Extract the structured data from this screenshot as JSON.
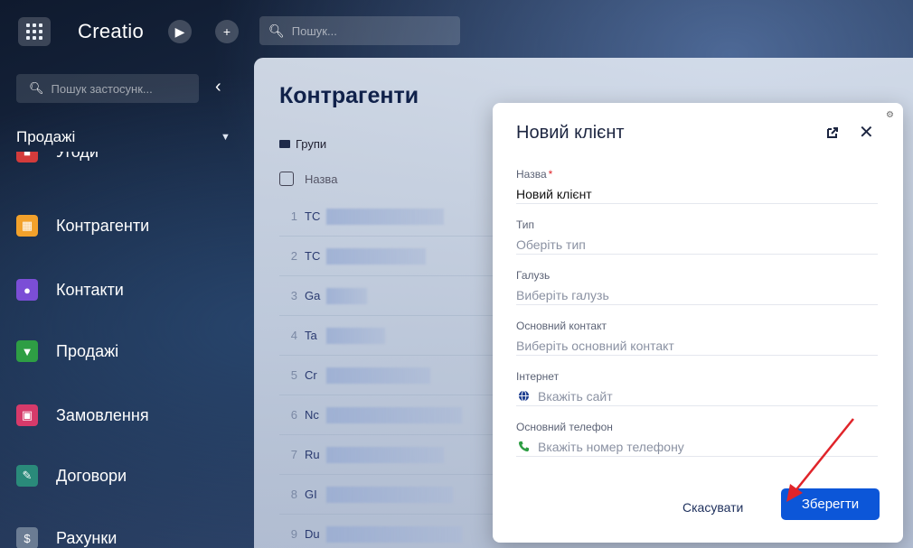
{
  "topbar": {
    "logo": "Creatio",
    "search_placeholder": "Пошук..."
  },
  "sidebar": {
    "search_placeholder": "Пошук застосунк...",
    "section_title": "Продажі",
    "items": [
      {
        "label": "Угоди",
        "icon": "deals-icon",
        "color": "#d33b3b"
      },
      {
        "label": "Контрагенти",
        "icon": "building-icon",
        "color": "#f2a12b"
      },
      {
        "label": "Контакти",
        "icon": "person-icon",
        "color": "#7b4ed6"
      },
      {
        "label": "Продажі",
        "icon": "funnel-icon",
        "color": "#2e9e44"
      },
      {
        "label": "Замовлення",
        "icon": "cart-icon",
        "color": "#d63a6a"
      },
      {
        "label": "Договори",
        "icon": "contract-icon",
        "color": "#2a8a7a"
      },
      {
        "label": "Рахунки",
        "icon": "invoice-icon",
        "color": "#6b7c93"
      }
    ]
  },
  "main": {
    "title": "Контрагенти",
    "groups_label": "Групи",
    "column_name": "Назва",
    "rows": [
      {
        "num": "1",
        "name": "TC"
      },
      {
        "num": "2",
        "name": "TC"
      },
      {
        "num": "3",
        "name": "Ga"
      },
      {
        "num": "4",
        "name": "Ta"
      },
      {
        "num": "5",
        "name": "Cr"
      },
      {
        "num": "6",
        "name": "Nc"
      },
      {
        "num": "7",
        "name": "Ru"
      },
      {
        "num": "8",
        "name": "GI"
      },
      {
        "num": "9",
        "name": "Du"
      }
    ]
  },
  "modal": {
    "title": "Новий клієнт",
    "fields": {
      "name_label": "Назва",
      "name_value": "Новий клієнт",
      "type_label": "Тип",
      "type_placeholder": "Оберіть тип",
      "industry_label": "Галузь",
      "industry_placeholder": "Виберіть галузь",
      "contact_label": "Основний контакт",
      "contact_placeholder": "Виберіть основний контакт",
      "web_label": "Інтернет",
      "web_placeholder": "Вкажіть сайт",
      "phone_label": "Основний телефон",
      "phone_placeholder": "Вкажіть номер телефону"
    },
    "cancel_label": "Скасувати",
    "save_label": "Зберегти"
  },
  "colors": {
    "primary": "#0c56d8",
    "required": "#e0242a",
    "annotation_arrow": "#e0242a"
  }
}
